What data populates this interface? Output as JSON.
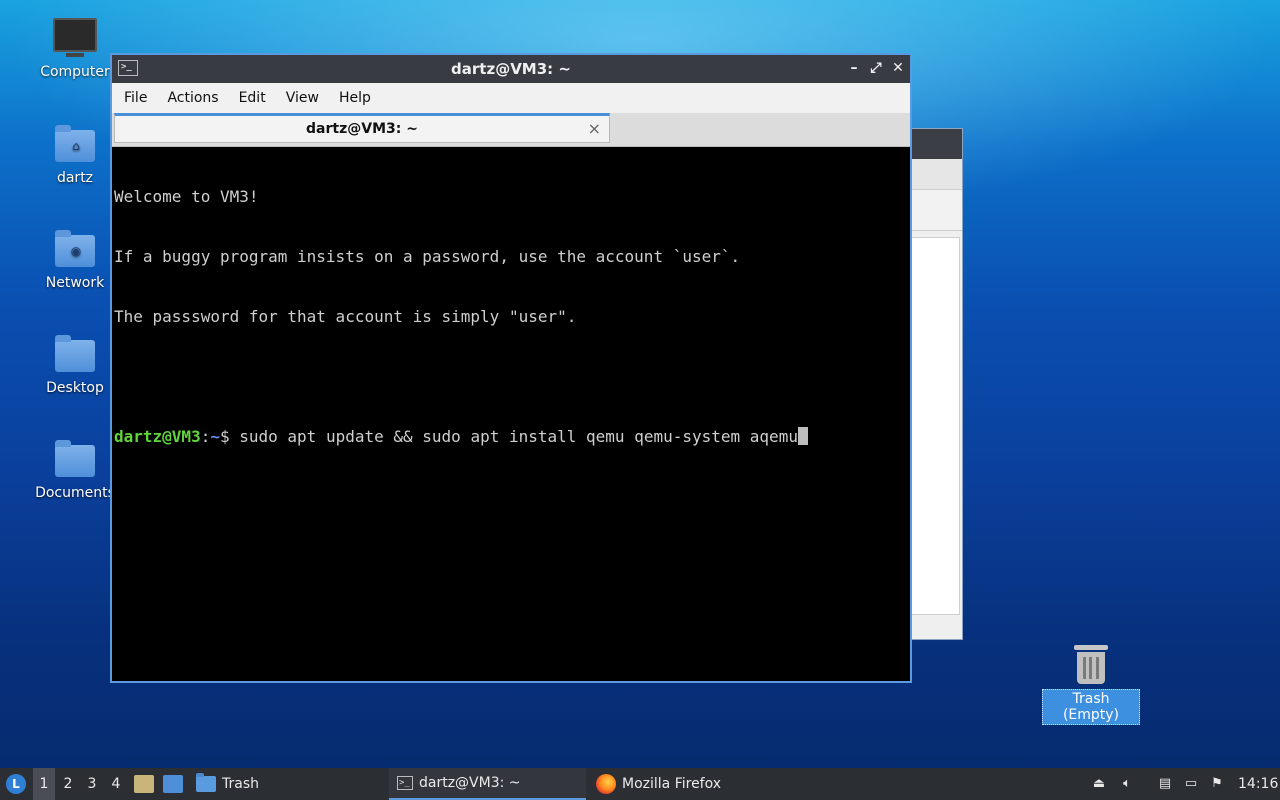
{
  "desktop": {
    "icons": [
      {
        "label": "Computer",
        "icon": "computer-icon"
      },
      {
        "label": "dartz",
        "icon": "home-folder-icon"
      },
      {
        "label": "Network",
        "icon": "network-folder-icon"
      },
      {
        "label": "Desktop",
        "icon": "folder-icon"
      },
      {
        "label": "Documents",
        "icon": "folder-icon"
      }
    ],
    "trash": {
      "label": "Trash (Empty)",
      "icon": "trash-icon"
    }
  },
  "terminal": {
    "window_title": "dartz@VM3: ~",
    "menu": [
      "File",
      "Actions",
      "Edit",
      "View",
      "Help"
    ],
    "tab_label": "dartz@VM3: ~",
    "tab_close": "×",
    "lines": [
      "Welcome to VM3!",
      "If a buggy program insists on a password, use the account `user`.",
      "The passsword for that account is simply \"user\"."
    ],
    "prompt": {
      "user_host": "dartz@VM3",
      "colon": ":",
      "path": "~",
      "symbol": "$ ",
      "command": "sudo apt update && sudo apt install qemu qemu-system aqemu"
    },
    "buttons": {
      "minimize": "–",
      "maximize": "⤢",
      "close": "✕"
    }
  },
  "taskbar": {
    "workspaces": [
      "1",
      "2",
      "3",
      "4"
    ],
    "tasks": [
      {
        "label": "Trash",
        "icon": "folder-icon"
      },
      {
        "label": "dartz@VM3: ~",
        "icon": "terminal-icon"
      },
      {
        "label": "Mozilla Firefox",
        "icon": "firefox-icon"
      }
    ],
    "clock": "14:16"
  }
}
